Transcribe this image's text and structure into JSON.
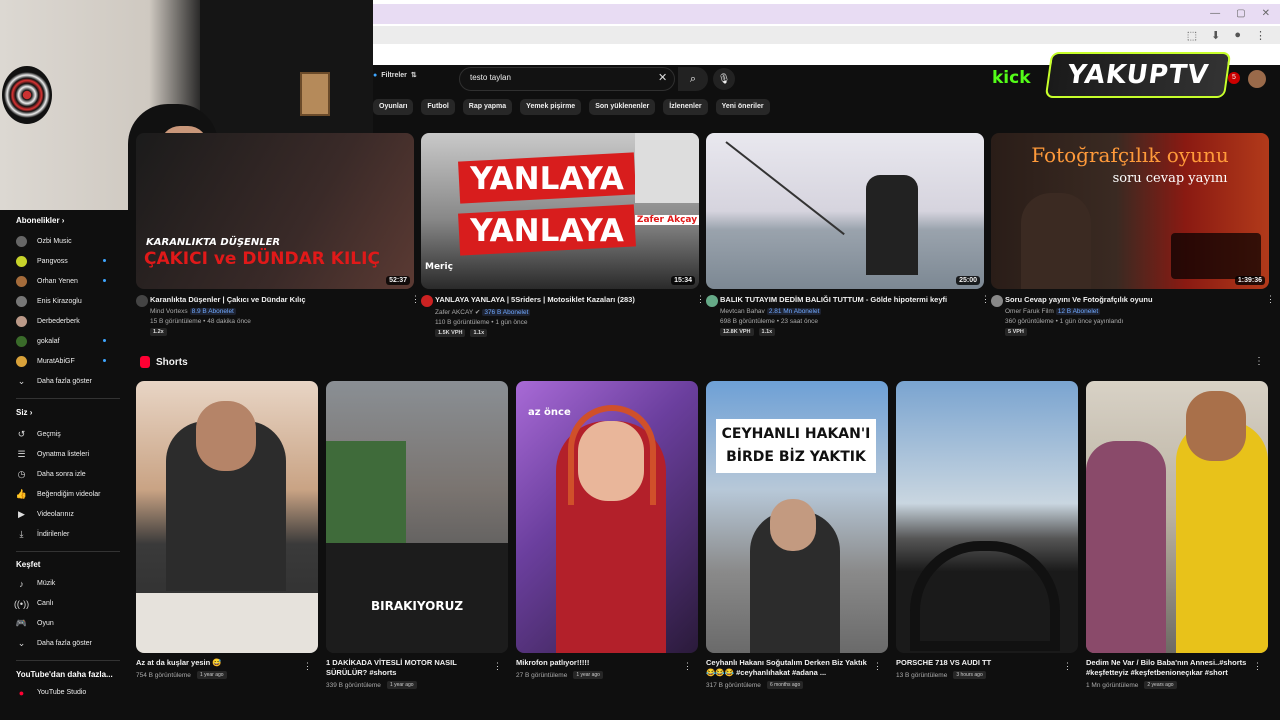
{
  "header": {
    "filters_label": "Filtreler",
    "search_value": "testo taylan",
    "kick_label": "kick",
    "yakup_label": "YAKUPTV",
    "notif_count": "5"
  },
  "webcam": {
    "logo": "logi"
  },
  "chips": [
    "Oyunları",
    "Futbol",
    "Rap yapma",
    "Yemek pişirme",
    "Son yüklenenler",
    "İzlenenler",
    "Yeni öneriler"
  ],
  "sidebar": {
    "subs_title": "Abonelikler",
    "subs": [
      "Ozbi Music",
      "Pangvoss",
      "Orhan Yenen",
      "Enis Kirazoglu",
      "Derbederberk",
      "gokalaf",
      "MuratAbiGF"
    ],
    "subs_more": "Daha fazla göster",
    "you_title": "Siz",
    "you_items": [
      "Geçmiş",
      "Oynatma listeleri",
      "Daha sonra izle",
      "Beğendiğim videolar",
      "Videolarınız",
      "İndirilenler"
    ],
    "explore_title": "Keşfet",
    "explore_items": [
      "Müzik",
      "Canlı",
      "Oyun"
    ],
    "explore_more": "Daha fazla göster",
    "more_title": "YouTube'dan daha fazla...",
    "studio": "YouTube Studio"
  },
  "videos": [
    {
      "title": "Karanlıkta Düşenler | Çakıcı ve Dündar Kılıç",
      "channel": "Mind Vortexs",
      "subs": "8.9 B Abonelet",
      "stats": "15 B görüntüleme • 48 dakika önce",
      "tags": [
        "1.2x"
      ],
      "duration": "52:37",
      "overlay1": "KARANLIKTA DÜŞENLER",
      "overlay2": "ÇAKICI ve DÜNDAR KILIÇ"
    },
    {
      "title": "YANLAYA YANLAYA | 5Sriders | Motosiklet Kazaları (283)",
      "channel": "Zafer AKCAY",
      "subs": "376 B Abonelet",
      "stats": "110 B görüntüleme • 1 gün önce",
      "tags": [
        "1.5K VPH",
        "1.1x"
      ],
      "duration": "15:34",
      "overlay1": "YANLAYA",
      "overlay2": "YANLAYA",
      "overlay3": "Zafer Akçay",
      "overlay4": "Meriç"
    },
    {
      "title": "BALIK TUTAYIM DEDİM BALIĞI TUTTUM - Gölde hipotermi keyfi",
      "channel": "Mevtcan Bahav",
      "subs": "2.81 Mn Abonelet",
      "stats": "698 B görüntüleme • 23 saat önce",
      "tags": [
        "12.8K VPH",
        "1.1x"
      ],
      "duration": "25:00"
    },
    {
      "title": "Soru Cevap yayını Ve Fotoğrafçılık oyunu",
      "channel": "Omer Faruk Film",
      "subs": "12 B Abonelet",
      "stats": "360 görüntüleme • 1 gün önce yayınlandı",
      "tags": [
        "5 VPH"
      ],
      "duration": "1:39:36",
      "overlay1": "Fotoğrafçılık oyunu",
      "overlay2": "soru cevap yayını"
    }
  ],
  "shorts_title": "Shorts",
  "shorts": [
    {
      "title": "Az at da kuşlar yesin 😅",
      "views": "754 B görüntüleme",
      "ago": "1 year ago"
    },
    {
      "title": "1 DAKİKADA VİTESLİ MOTOR NASIL SÜRÜLÜR? #shorts",
      "views": "339 B görüntüleme",
      "ago": "1 year ago",
      "overlay": "BIRAKIYORUZ"
    },
    {
      "title": "Mikrofon patlıyor!!!!!",
      "views": "27 B görüntüleme",
      "ago": "1 year ago",
      "overlay": "az önce"
    },
    {
      "title": "Ceyhanlı Hakanı Soğutalım Derken Biz Yaktık 😂😂😂 #ceyhanlıhakat #adana ...",
      "views": "317 B görüntüleme",
      "ago": "6 months ago",
      "overlay": "CEYHANLI HAKAN'I BİRDE BİZ YAKTIK"
    },
    {
      "title": "PORSCHE 718 VS AUDI TT",
      "views": "13 B görüntüleme",
      "ago": "3 hours ago"
    },
    {
      "title": "Dedim Ne Var / Bilo Baba'nın Annesi..#shorts #keşfetteyiz #keşfetbenioneçıkar #short",
      "views": "1 Mn görüntüleme",
      "ago": "2 years ago"
    }
  ]
}
